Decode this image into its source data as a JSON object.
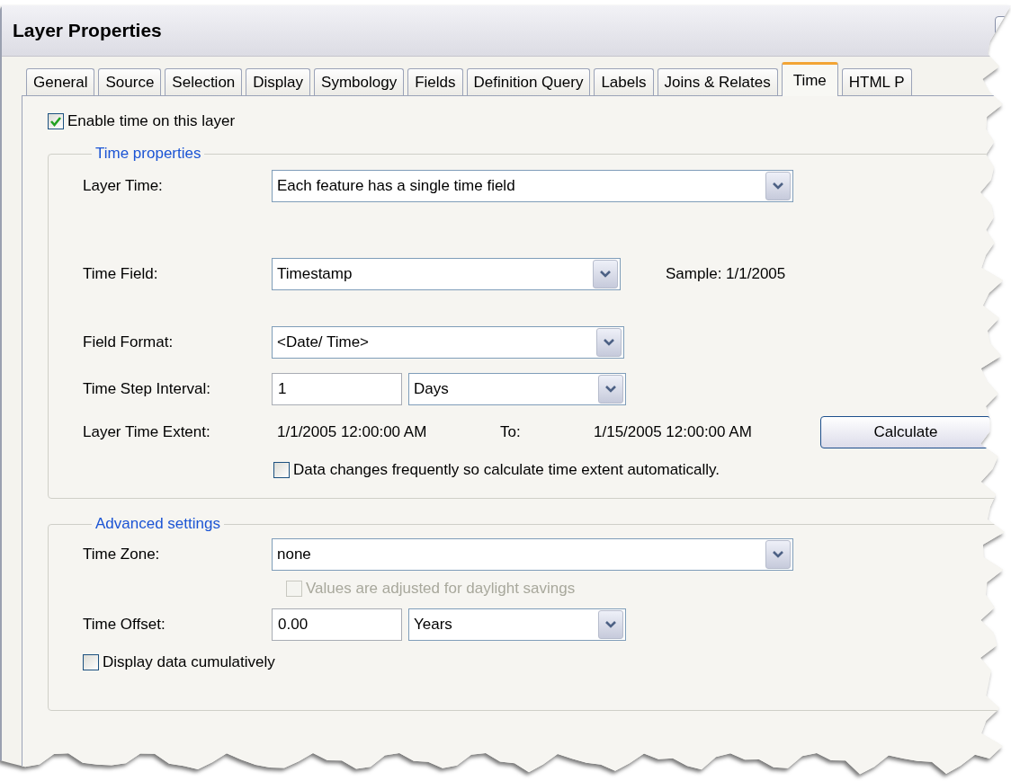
{
  "window": {
    "title": "Layer Properties"
  },
  "tabs": [
    {
      "label": "General",
      "selected": false
    },
    {
      "label": "Source",
      "selected": false
    },
    {
      "label": "Selection",
      "selected": false
    },
    {
      "label": "Display",
      "selected": false
    },
    {
      "label": "Symbology",
      "selected": false
    },
    {
      "label": "Fields",
      "selected": false
    },
    {
      "label": "Definition Query",
      "selected": false
    },
    {
      "label": "Labels",
      "selected": false
    },
    {
      "label": "Joins & Relates",
      "selected": false
    },
    {
      "label": "Time",
      "selected": true
    },
    {
      "label": "HTML P",
      "selected": false
    }
  ],
  "enable_time": {
    "label": "Enable time on this layer",
    "checked": true
  },
  "time_properties": {
    "title": "Time properties",
    "layer_time": {
      "label": "Layer Time:",
      "value": "Each feature has a single time field"
    },
    "time_field": {
      "label": "Time Field:",
      "value": "Timestamp",
      "sample": "Sample: 1/1/2005"
    },
    "field_format": {
      "label": "Field Format:",
      "value": "<Date/ Time>"
    },
    "time_step_interval": {
      "label": "Time Step Interval:",
      "value": "1",
      "unit": "Days"
    },
    "layer_time_extent": {
      "label": "Layer Time Extent:",
      "start": "1/1/2005 12:00:00 AM",
      "to_label": "To:",
      "end": "1/15/2005 12:00:00 AM",
      "button": "Calculate"
    },
    "auto_calculate": {
      "label": "Data changes frequently so calculate time extent automatically.",
      "checked": false
    }
  },
  "advanced_settings": {
    "title": "Advanced settings",
    "time_zone": {
      "label": "Time Zone:",
      "value": "none"
    },
    "daylight_savings": {
      "label": "Values are adjusted for daylight savings",
      "checked": false,
      "disabled": true
    },
    "time_offset": {
      "label": "Time Offset:",
      "value": "0.00",
      "unit": "Years"
    },
    "display_cumulatively": {
      "label": "Display data cumulatively",
      "checked": false
    }
  }
}
